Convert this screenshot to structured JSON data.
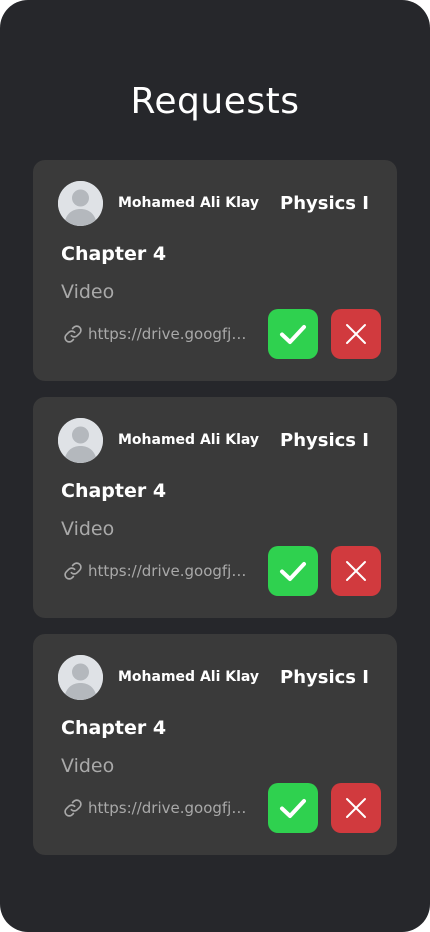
{
  "page": {
    "title": "Requests"
  },
  "colors": {
    "background": "#26272b",
    "card": "#3a3a3a",
    "accept": "#2fd14f",
    "reject": "#d13a3e",
    "muted_text": "#a9a9a9"
  },
  "requests": [
    {
      "user_name": "Mohamed Ali Klay",
      "subject": "Physics I",
      "chapter": "Chapter 4",
      "type": "Video",
      "link": "https://drive.googfjoe..."
    },
    {
      "user_name": "Mohamed Ali Klay",
      "subject": "Physics I",
      "chapter": "Chapter 4",
      "type": "Video",
      "link": "https://drive.googfjoe..."
    },
    {
      "user_name": "Mohamed Ali Klay",
      "subject": "Physics I",
      "chapter": "Chapter 4",
      "type": "Video",
      "link": "https://drive.googfjoe..."
    }
  ],
  "icons": {
    "avatar": "user-avatar-icon",
    "link": "link-icon",
    "accept": "checkmark-icon",
    "reject": "close-icon"
  }
}
